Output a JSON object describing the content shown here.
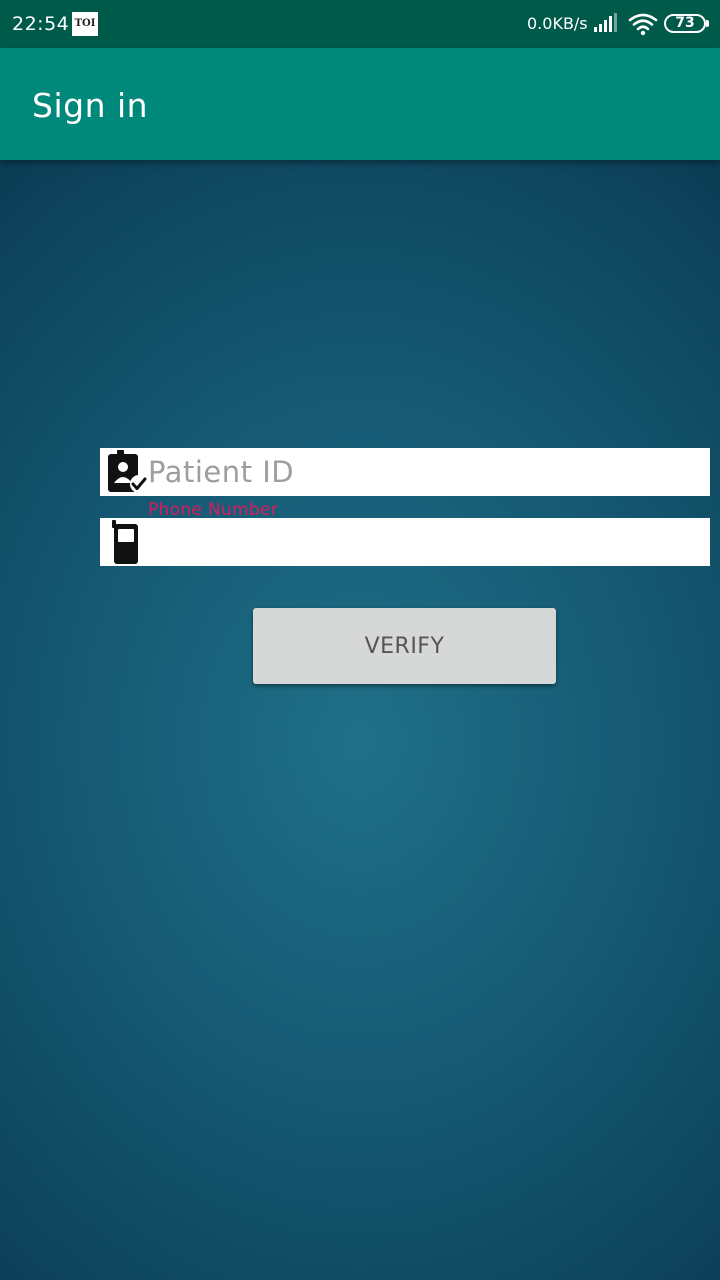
{
  "status_bar": {
    "time": "22:54",
    "notification_badge": "TOI",
    "network_speed": "0.0KB/s",
    "battery": "73",
    "icons": [
      "signal-icon",
      "wifi-icon",
      "battery-icon"
    ]
  },
  "app_bar": {
    "title": "Sign in",
    "color": "#00897b"
  },
  "form": {
    "patient_id": {
      "placeholder": "Patient ID",
      "value": "",
      "icon": "patient-id-badge-icon"
    },
    "phone_number": {
      "label": "Phone Number",
      "value": "",
      "icon": "mobile-phone-icon"
    },
    "verify_label": "VERIFY"
  },
  "colors": {
    "status_bar": "#005a4a",
    "accent": "#d81b60",
    "button": "#d6d7d7"
  }
}
